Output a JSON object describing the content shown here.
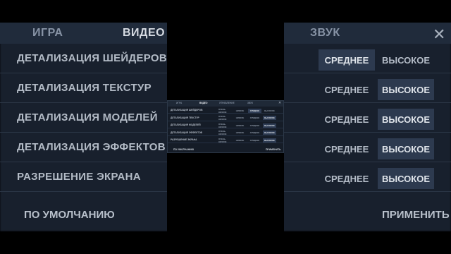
{
  "bg": {
    "tabs": [
      "ИГРА",
      "ВИДЕО",
      "ЗВУК"
    ],
    "rows": [
      {
        "label": "ДЕТАЛИЗАЦИЯ ШЕЙДЕРОВ",
        "mid": "СРЕДНЕЕ",
        "high": "ВЫСОКОЕ",
        "selected": "mid"
      },
      {
        "label": "ДЕТАЛИЗАЦИЯ ТЕКСТУР",
        "mid": "СРЕДНЕЕ",
        "high": "ВЫСОКОЕ",
        "selected": "high"
      },
      {
        "label": "ДЕТАЛИЗАЦИЯ МОДЕЛЕЙ",
        "mid": "СРЕДНЕЕ",
        "high": "ВЫСОКОЕ",
        "selected": "high"
      },
      {
        "label": "ДЕТАЛИЗАЦИЯ ЭФФЕКТОВ",
        "mid": "СРЕДНЕЕ",
        "high": "ВЫСОКОЕ",
        "selected": "high"
      },
      {
        "label": "РАЗРЕШЕНИЕ ЭКРАНА",
        "mid": "СРЕДНЕЕ",
        "high": "ВЫСОКОЕ",
        "selected": "high"
      }
    ],
    "reset": "ПО УМОЛЧАНИЮ",
    "apply": "ПРИМЕНИТЬ",
    "close": "✕"
  },
  "modal": {
    "tabs": [
      "ИГРА",
      "ВИДЕО",
      "УПРАВЛЕНИЕ",
      "ЗВУК"
    ],
    "rows": [
      {
        "label": "ДЕТАЛИЗАЦИЯ ШЕЙДЕРОВ",
        "opts": [
          "ОЧЕНЬ НИЗКОЕ",
          "НИЗКОЕ",
          "СРЕДНЕЕ",
          "ВЫСОКОЕ"
        ],
        "selected": 2
      },
      {
        "label": "ДЕТАЛИЗАЦИЯ ТЕКСТУР",
        "opts": [
          "ОЧЕНЬ НИЗКОЕ",
          "НИЗКОЕ",
          "СРЕДНЕЕ",
          "ВЫСОКОЕ"
        ],
        "selected": 3
      },
      {
        "label": "ДЕТАЛИЗАЦИЯ МОДЕЛЕЙ",
        "opts": [
          "ОЧЕНЬ НИЗКОЕ",
          "НИЗКОЕ",
          "СРЕДНЕЕ",
          "ВЫСОКОЕ"
        ],
        "selected": 3
      },
      {
        "label": "ДЕТАЛИЗАЦИЯ ЭФФЕКТОВ",
        "opts": [
          "ОЧЕНЬ НИЗКОЕ",
          "НИЗКОЕ",
          "СРЕДНЕЕ",
          "ВЫСОКОЕ"
        ],
        "selected": 3
      },
      {
        "label": "РАЗРЕШЕНИЕ ЭКРАНА",
        "opts": [
          "ОЧЕНЬ НИЗКОЕ",
          "НИЗКОЕ",
          "СРЕДНЕЕ",
          "ВЫСОКОЕ"
        ],
        "selected": 3
      }
    ],
    "reset": "ПО УМОЛЧАНИЮ",
    "apply": "ПРИМЕНИТЬ",
    "close": "✕"
  }
}
